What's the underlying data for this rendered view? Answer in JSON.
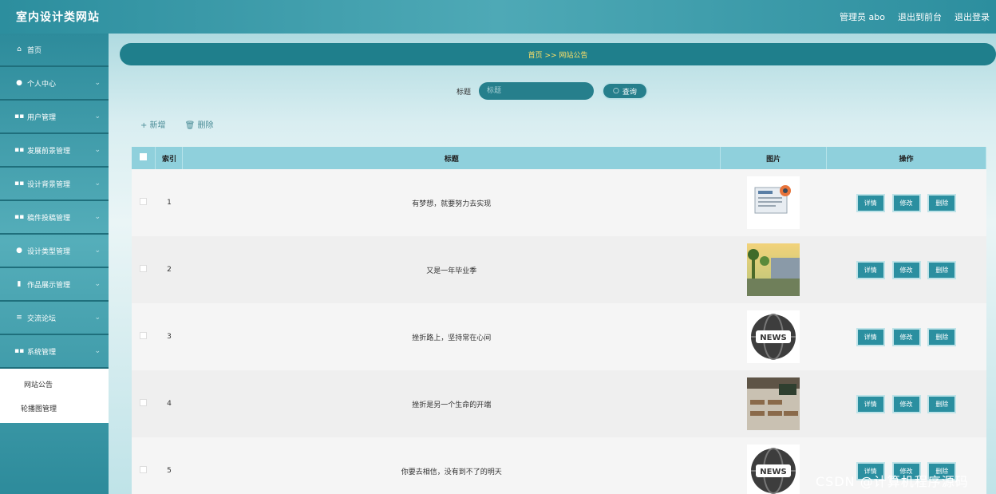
{
  "header": {
    "title": "室内设计类网站",
    "admin_label": "管理员 abo",
    "back_label": "退出到前台",
    "logout_label": "退出登录"
  },
  "sidebar": {
    "items": [
      {
        "label": "首页",
        "icon": "home-icon",
        "glyph": "⌂"
      },
      {
        "label": "个人中心",
        "icon": "user-icon",
        "glyph": "●"
      },
      {
        "label": "用户管理",
        "icon": "grid-icon",
        "glyph": "▪▪"
      },
      {
        "label": "发展前景管理",
        "icon": "grid-icon",
        "glyph": "▪▪"
      },
      {
        "label": "设计背景管理",
        "icon": "grid-icon",
        "glyph": "▪▪"
      },
      {
        "label": "稿件投稿管理",
        "icon": "grid-icon",
        "glyph": "▪▪"
      },
      {
        "label": "设计类型管理",
        "icon": "bulb-icon",
        "glyph": "●"
      },
      {
        "label": "作品展示管理",
        "icon": "trash-icon",
        "glyph": "▮"
      },
      {
        "label": "交流论坛",
        "icon": "list-icon",
        "glyph": "≡"
      },
      {
        "label": "系统管理",
        "icon": "grid-icon",
        "glyph": "▪▪"
      }
    ],
    "submenu": [
      "网站公告",
      "轮播图管理"
    ]
  },
  "breadcrumb": "首页  >>  网站公告",
  "search": {
    "label": "标题",
    "placeholder": "标题",
    "button": "查询"
  },
  "actions": {
    "add": "+ 新增",
    "delete": "删除"
  },
  "table": {
    "headers": [
      "索引",
      "标题",
      "图片",
      "操作"
    ],
    "rows": [
      {
        "index": "1",
        "title": "有梦想，就要努力去实现"
      },
      {
        "index": "2",
        "title": "又是一年毕业季"
      },
      {
        "index": "3",
        "title": "挫折路上，坚持常在心间"
      },
      {
        "index": "4",
        "title": "挫折是另一个生命的开端"
      },
      {
        "index": "5",
        "title": "你要去相信，没有到不了的明天"
      }
    ],
    "row_buttons": {
      "detail": "详情",
      "edit": "修改",
      "delete": "删除"
    }
  },
  "watermark": "CSDN @计算机程序源码",
  "colors": {
    "primary": "#2b8fa0",
    "breadcrumb_text": "#ffe066"
  }
}
